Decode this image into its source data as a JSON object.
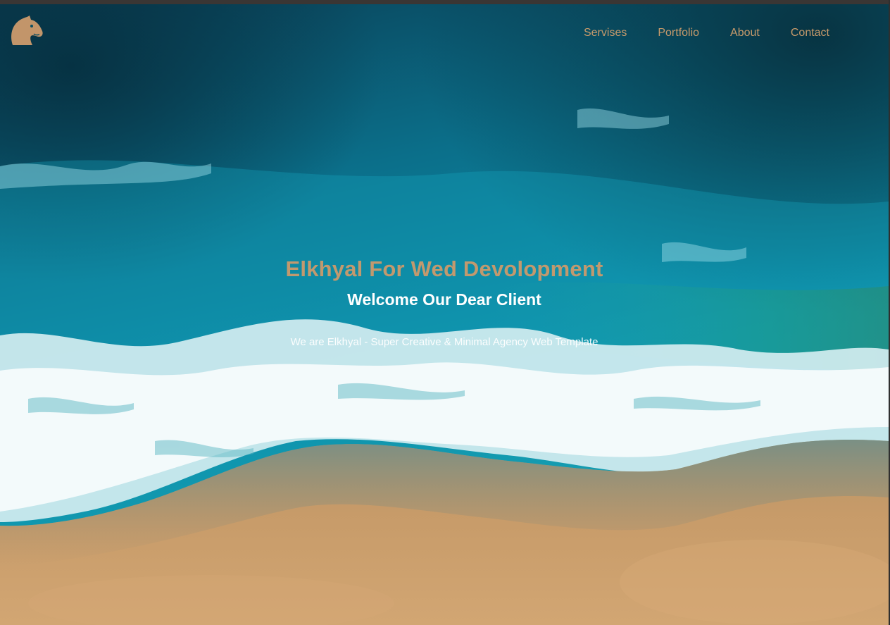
{
  "navbar": {
    "logo_icon": "horse-head-icon",
    "links": [
      {
        "label": "Servises"
      },
      {
        "label": "Portfolio"
      },
      {
        "label": "About"
      },
      {
        "label": "Contact"
      }
    ]
  },
  "hero": {
    "title": "Elkhyal For Wed Devolopment",
    "subtitle": "Welcome Our Dear Client",
    "text": "We are Elkhyal - Super Creative & Minimal Agency Web Template",
    "background": "aerial-ocean-beach-image"
  },
  "colors": {
    "accent": "#c2996e",
    "nav_text": "#c79a6b",
    "ocean_deep": "#0a4f63",
    "ocean": "#0f8aa6",
    "sand": "#c89a68",
    "foam": "#e8f4f6"
  }
}
